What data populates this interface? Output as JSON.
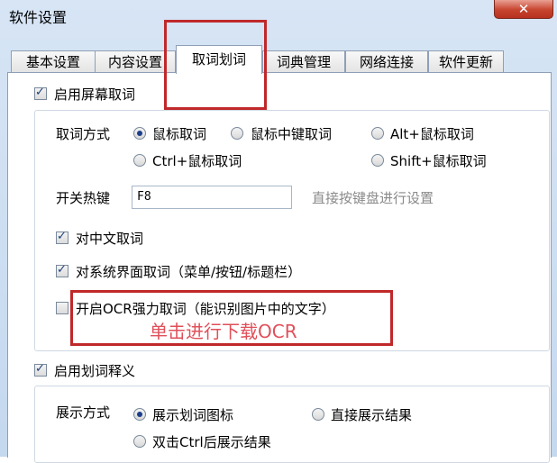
{
  "window": {
    "title": "软件设置",
    "close_glyph": "✕"
  },
  "tabs": [
    "基本设置",
    "内容设置",
    "取词划词",
    "词典管理",
    "网络连接",
    "软件更新"
  ],
  "screen_capture": {
    "enable_label": "启用屏幕取词",
    "mode_label": "取词方式",
    "modes": [
      "鼠标取词",
      "鼠标中键取词",
      "Alt+鼠标取词",
      "Ctrl+鼠标取词",
      "Shift+鼠标取词"
    ],
    "selected_mode": "鼠标取词",
    "hotkey_label": "开关热键",
    "hotkey_value": "F8",
    "hotkey_hint": "直接按键盘进行设置",
    "chinese_label": "对中文取词",
    "system_ui_label": "对系统界面取词（菜单/按钮/标题栏）",
    "ocr_label": "开启OCR强力取词（能识别图片中的文字）"
  },
  "selection": {
    "enable_label": "启用划词释义",
    "display_label": "展示方式",
    "options": [
      "展示划词图标",
      "直接展示结果",
      "双击Ctrl后展示结果"
    ],
    "selected": "展示划词图标"
  },
  "annotation": {
    "text": "单击进行下载OCR",
    "color": "#c0282a"
  }
}
